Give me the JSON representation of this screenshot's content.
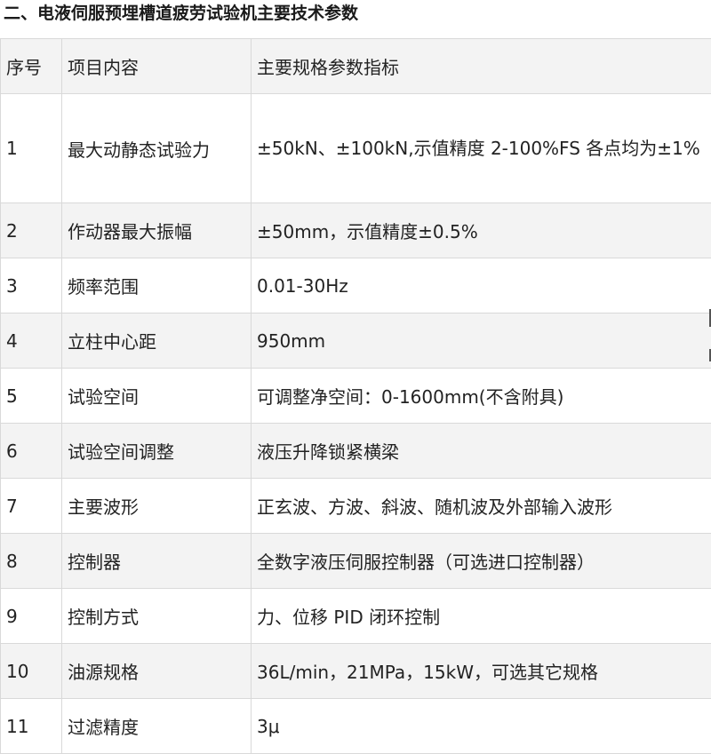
{
  "heading": "二、电液伺服预埋槽道疲劳试验机主要技术参数",
  "table": {
    "headers": [
      "序号",
      "项目内容",
      "主要规格参数指标"
    ],
    "rows": [
      {
        "no": "1",
        "item": "最大动静态试验力",
        "spec": "±50kN、±100kN,示值精度 2-100%FS 各点均为±1%"
      },
      {
        "no": "2",
        "item": "作动器最大振幅",
        "spec": "±50mm，示值精度±0.5%"
      },
      {
        "no": "3",
        "item": "频率范围",
        "spec": "0.01-30Hz"
      },
      {
        "no": "4",
        "item": "立柱中心距",
        "spec": "950mm"
      },
      {
        "no": "5",
        "item": "试验空间",
        "spec": "可调整净空间：0-1600mm(不含附具)"
      },
      {
        "no": "6",
        "item": "试验空间调整",
        "spec": "液压升降锁紧横梁"
      },
      {
        "no": "7",
        "item": "主要波形",
        "spec": "正玄波、方波、斜波、随机波及外部输入波形"
      },
      {
        "no": "8",
        "item": "控制器",
        "spec": "全数字液压伺服控制器（可选进口控制器）"
      },
      {
        "no": "9",
        "item": "控制方式",
        "spec": "力、位移 PID 闭环控制"
      },
      {
        "no": "10",
        "item": "油源规格",
        "spec": "36L/min，21MPa，15kW，可选其它规格"
      },
      {
        "no": "11",
        "item": "过滤精度",
        "spec": "3μ"
      }
    ]
  }
}
